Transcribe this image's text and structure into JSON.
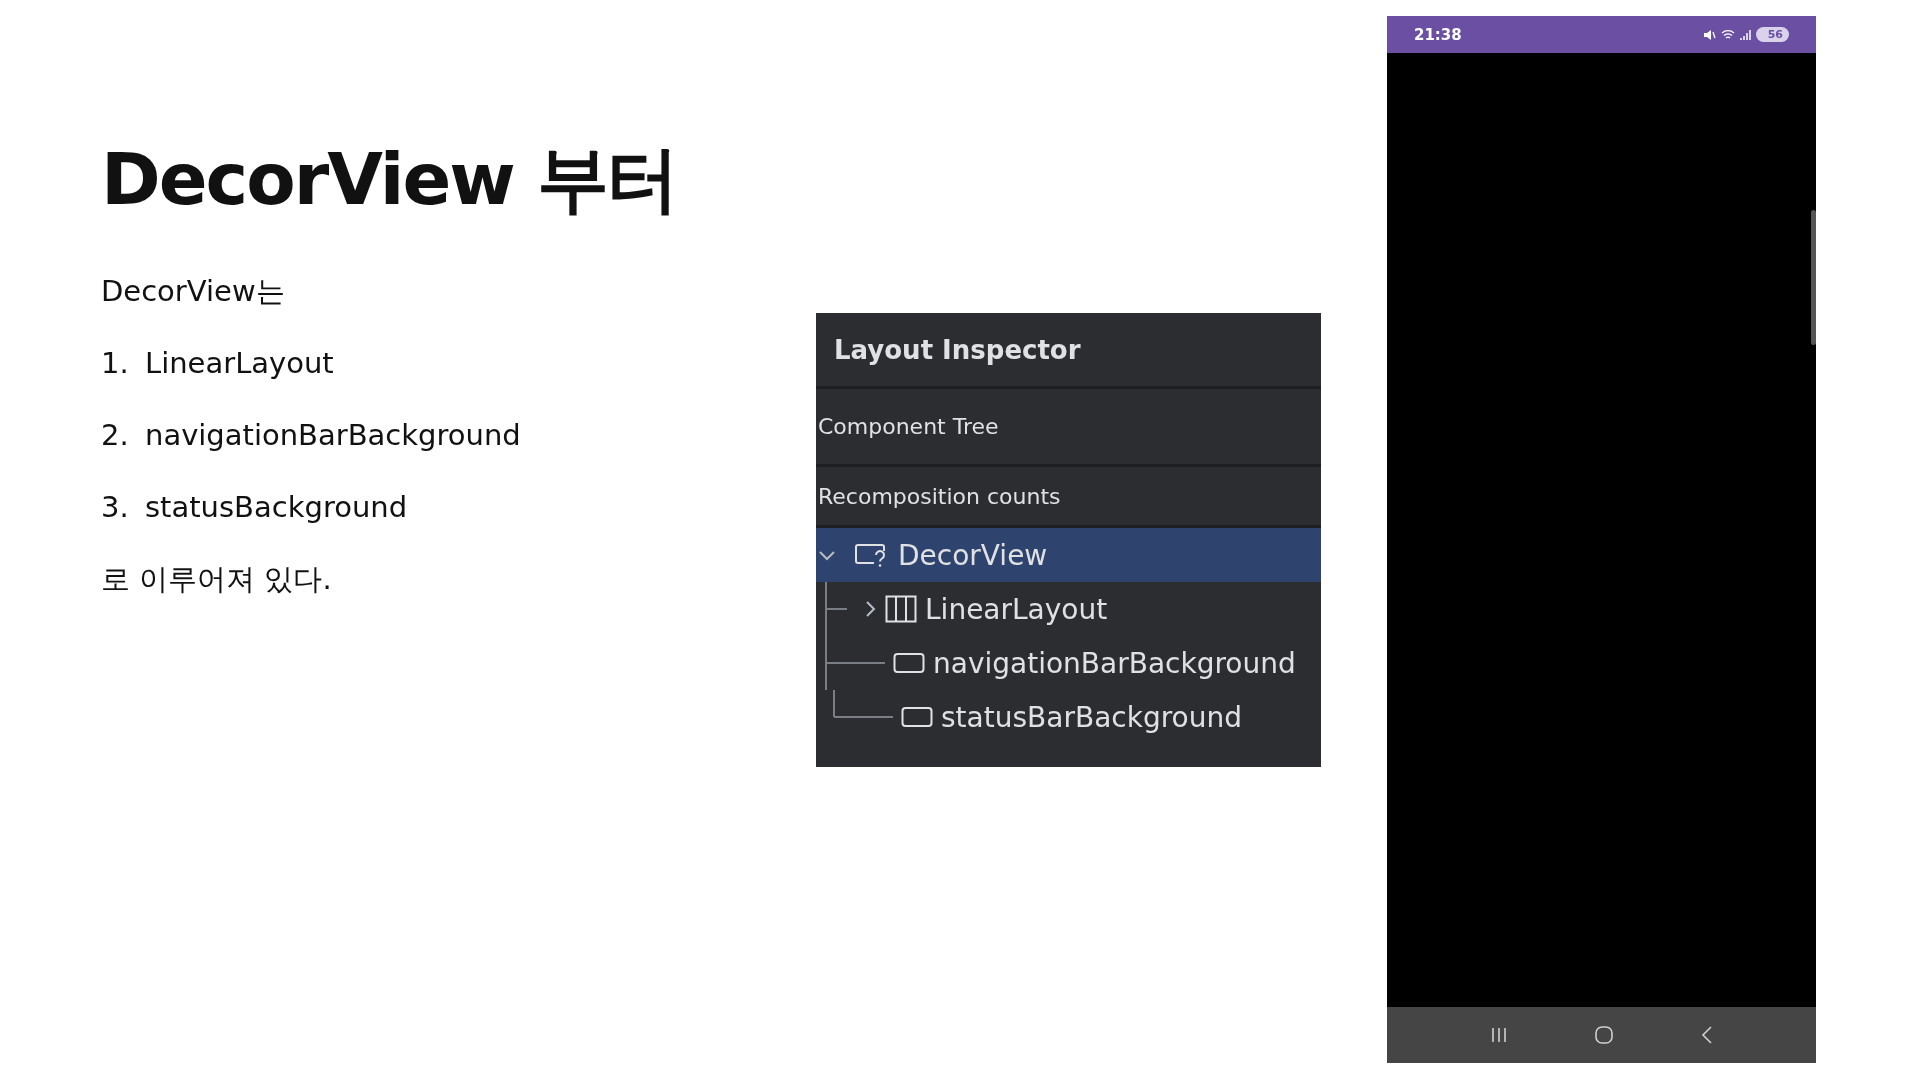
{
  "slide": {
    "title": "DecorView 부터",
    "intro": "DecorView는",
    "items": [
      {
        "number": "1.",
        "text": "LinearLayout"
      },
      {
        "number": "2.",
        "text": "navigationBarBackground"
      },
      {
        "number": "3.",
        "text": "statusBackground"
      }
    ],
    "conclusion": "로 이루어져 있다."
  },
  "inspector": {
    "title": "Layout Inspector",
    "sections": [
      "Component Tree",
      "Recomposition counts"
    ],
    "tree": [
      {
        "label": "DecorView",
        "kind": "unknown",
        "expanded": true,
        "selected": true,
        "children": [
          {
            "label": "LinearLayout",
            "kind": "linear",
            "expanded": false,
            "selected": false
          },
          {
            "label": "navigationBarBackground",
            "kind": "view",
            "selected": false
          },
          {
            "label": "statusBarBackground",
            "kind": "view",
            "selected": false
          }
        ]
      }
    ]
  },
  "phone": {
    "status_bar": {
      "time": "21:38",
      "battery": "56"
    }
  }
}
